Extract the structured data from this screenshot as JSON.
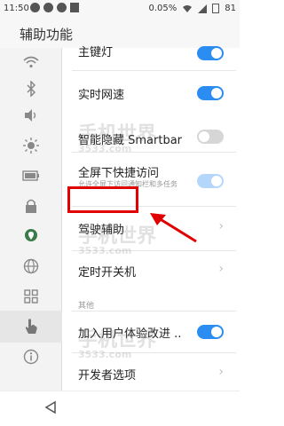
{
  "status_bar": {
    "time": "11:50",
    "data_usage": "0.05%",
    "battery": "81"
  },
  "header": {
    "title": "辅助功能"
  },
  "sidebar": {
    "icons": [
      "wifi-icon",
      "bluetooth-icon",
      "sound-icon",
      "brightness-icon",
      "battery-icon",
      "lock-icon",
      "location-icon",
      "globe-icon",
      "grid-apps-icon",
      "hand-icon",
      "info-icon"
    ],
    "active_index": 9
  },
  "list": {
    "item_top": {
      "label": "主键灯",
      "on": true
    },
    "item_speed": {
      "label": "实时网速",
      "on": true
    },
    "item_smartbar": {
      "label": "智能隐藏 Smartbar",
      "on": false
    },
    "item_fullscreen": {
      "label": "全屏下快捷访问",
      "sub": "允许全屏下访问通知栏和多任务",
      "on": true
    },
    "item_driving": {
      "label": "驾驶辅助"
    },
    "item_timer": {
      "label": "定时开关机"
    },
    "section_other": "其他",
    "item_experience": {
      "label": "加入用户体验改进 ..",
      "on": true
    },
    "item_developer": {
      "label": "开发者选项"
    }
  },
  "watermarks": {
    "text": "手机世界",
    "site": "3533.com"
  },
  "colors": {
    "accent": "#2b8cf2",
    "highlight": "#e00000"
  }
}
